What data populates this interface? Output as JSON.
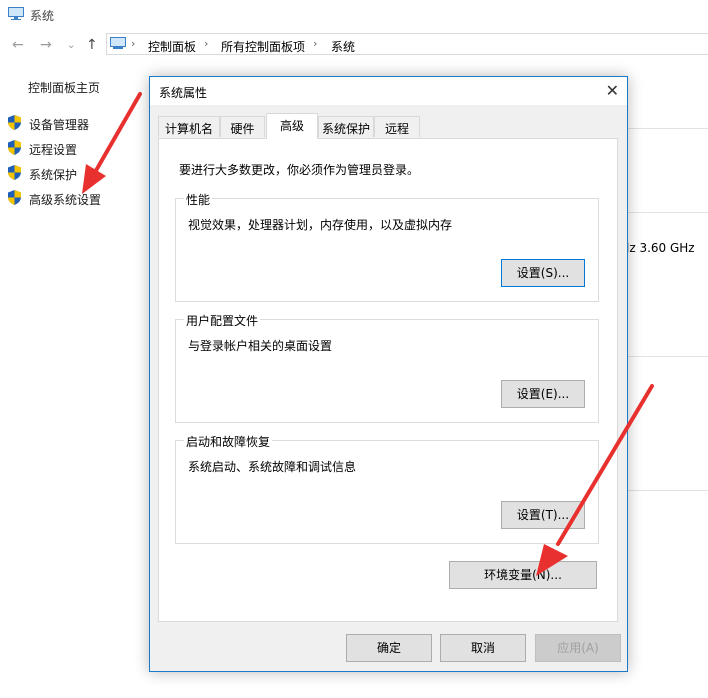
{
  "window": {
    "title": "系统",
    "breadcrumb": [
      "控制面板",
      "所有控制面板项",
      "系统"
    ]
  },
  "sidebar": {
    "home": "控制面板主页",
    "items": [
      {
        "label": "设备管理器"
      },
      {
        "label": "远程设置"
      },
      {
        "label": "系统保护"
      },
      {
        "label": "高级系统设置"
      }
    ]
  },
  "background": {
    "cpu_speed": "lz   3.60 GHz"
  },
  "dialog": {
    "title": "系统属性",
    "tabs": [
      "计算机名",
      "硬件",
      "高级",
      "系统保护",
      "远程"
    ],
    "active_tab": "高级",
    "admin_note": "要进行大多数更改，你必须作为管理员登录。",
    "groups": [
      {
        "title": "性能",
        "desc": "视觉效果，处理器计划，内存使用，以及虚拟内存",
        "button": "设置(S)..."
      },
      {
        "title": "用户配置文件",
        "desc": "与登录帐户相关的桌面设置",
        "button": "设置(E)..."
      },
      {
        "title": "启动和故障恢复",
        "desc": "系统启动、系统故障和调试信息",
        "button": "设置(T)..."
      }
    ],
    "env_button": "环境变量(N)...",
    "ok_button": "确定",
    "cancel_button": "取消",
    "apply_button": "应用(A)"
  },
  "colors": {
    "accent": "#0078d7",
    "arrow": "#e8312f",
    "shield_blue": "#1f5fb8",
    "shield_yellow": "#f5c400"
  }
}
